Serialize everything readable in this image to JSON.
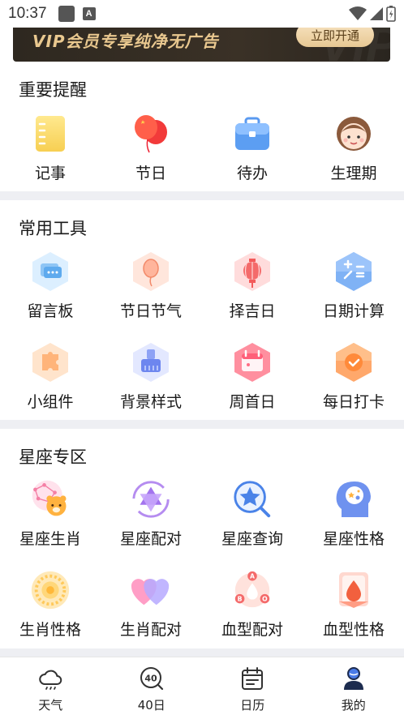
{
  "status_bar": {
    "time": "10:37",
    "app_icon_letter": "A"
  },
  "vip_banner": {
    "text": "VIP会员专享纯净无广告",
    "button_label": "立即开通",
    "deco_text": "VIP"
  },
  "reminders": {
    "title": "重要提醒",
    "items": [
      {
        "label": "记事",
        "icon": "notebook-icon"
      },
      {
        "label": "节日",
        "icon": "balloon-icon"
      },
      {
        "label": "待办",
        "icon": "briefcase-icon"
      },
      {
        "label": "生理期",
        "icon": "girl-face-icon"
      }
    ]
  },
  "tools": {
    "title": "常用工具",
    "items": [
      {
        "label": "留言板",
        "icon": "message-board-icon"
      },
      {
        "label": "节日节气",
        "icon": "balloon-icon"
      },
      {
        "label": "择吉日",
        "icon": "lantern-icon"
      },
      {
        "label": "日期计算",
        "icon": "calculator-icon"
      },
      {
        "label": "小组件",
        "icon": "puzzle-icon"
      },
      {
        "label": "背景样式",
        "icon": "brush-icon"
      },
      {
        "label": "周首日",
        "icon": "calendar-icon"
      },
      {
        "label": "每日打卡",
        "icon": "checkin-icon"
      }
    ]
  },
  "zodiac": {
    "title": "星座专区",
    "items": [
      {
        "label": "星座生肖",
        "icon": "constellation-tiger-icon"
      },
      {
        "label": "星座配对",
        "icon": "star-of-david-icon"
      },
      {
        "label": "星座查询",
        "icon": "star-search-icon"
      },
      {
        "label": "星座性格",
        "icon": "head-stars-icon"
      },
      {
        "label": "生肖性格",
        "icon": "sun-wheel-icon"
      },
      {
        "label": "生肖配对",
        "icon": "hearts-icon"
      },
      {
        "label": "血型配对",
        "icon": "blood-type-abo-icon"
      },
      {
        "label": "血型性格",
        "icon": "blood-drop-icon"
      }
    ]
  },
  "bottom_nav": [
    {
      "label": "天气",
      "icon": "weather-icon"
    },
    {
      "label": "40日",
      "icon": "forty-days-icon",
      "icon_text": "40"
    },
    {
      "label": "日历",
      "icon": "calendar-icon"
    },
    {
      "label": "我的",
      "icon": "profile-icon",
      "active": true
    }
  ],
  "colors": {
    "accent": "#4a7be8",
    "vip_gold": "#e9c88f",
    "divider": "#eeeff3"
  }
}
